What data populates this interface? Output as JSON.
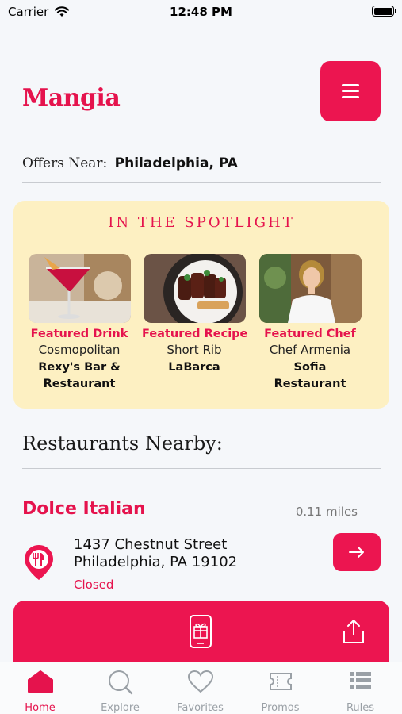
{
  "status_bar": {
    "carrier": "Carrier",
    "time": "12:48 PM"
  },
  "header": {
    "brand": "Mangia",
    "menu_icon": "hamburger-icon"
  },
  "offers": {
    "label": "Offers Near:",
    "city": "Philadelphia, PA"
  },
  "spotlight": {
    "title": "IN THE SPOTLIGHT",
    "cards": [
      {
        "category": "Featured Drink",
        "name": "Cosmopolitan",
        "place": "Rexy's Bar & Restaurant"
      },
      {
        "category": "Featured Recipe",
        "name": "Short Rib",
        "place": "LaBarca"
      },
      {
        "category": "Featured Chef",
        "name": "Chef Armenia",
        "place": "Sofia Restaurant"
      }
    ]
  },
  "nearby": {
    "title": "Restaurants Nearby:",
    "restaurant": {
      "name": "Dolce Italian",
      "distance": "0.11 miles",
      "address_line1": "1437 Chestnut Street",
      "address_line2": "Philadelphia, PA 19102",
      "status": "Closed"
    }
  },
  "tabs": [
    {
      "label": "Home",
      "icon": "home-icon",
      "active": true
    },
    {
      "label": "Explore",
      "icon": "search-icon",
      "active": false
    },
    {
      "label": "Favorites",
      "icon": "heart-icon",
      "active": false
    },
    {
      "label": "Promos",
      "icon": "ticket-icon",
      "active": false
    },
    {
      "label": "Rules",
      "icon": "list-icon",
      "active": false
    }
  ],
  "colors": {
    "accent": "#e5134d",
    "spotlight_bg": "#fdf0c2",
    "inactive": "#9aa0a6"
  }
}
